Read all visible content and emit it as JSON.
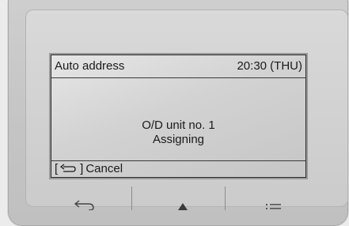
{
  "screen": {
    "title": "Auto address",
    "clock": "20:30 (THU)",
    "message_line1": "O/D unit no. 1",
    "message_line2": "Assigning",
    "footer": {
      "bracket_open": "[",
      "bracket_close": "]",
      "cancel_label": "Cancel",
      "icon": "return-arrow-icon"
    }
  },
  "buttons": [
    {
      "icon": "return-icon"
    },
    {
      "icon": "up-triangle-icon"
    },
    {
      "icon": "menu-list-icon"
    }
  ]
}
